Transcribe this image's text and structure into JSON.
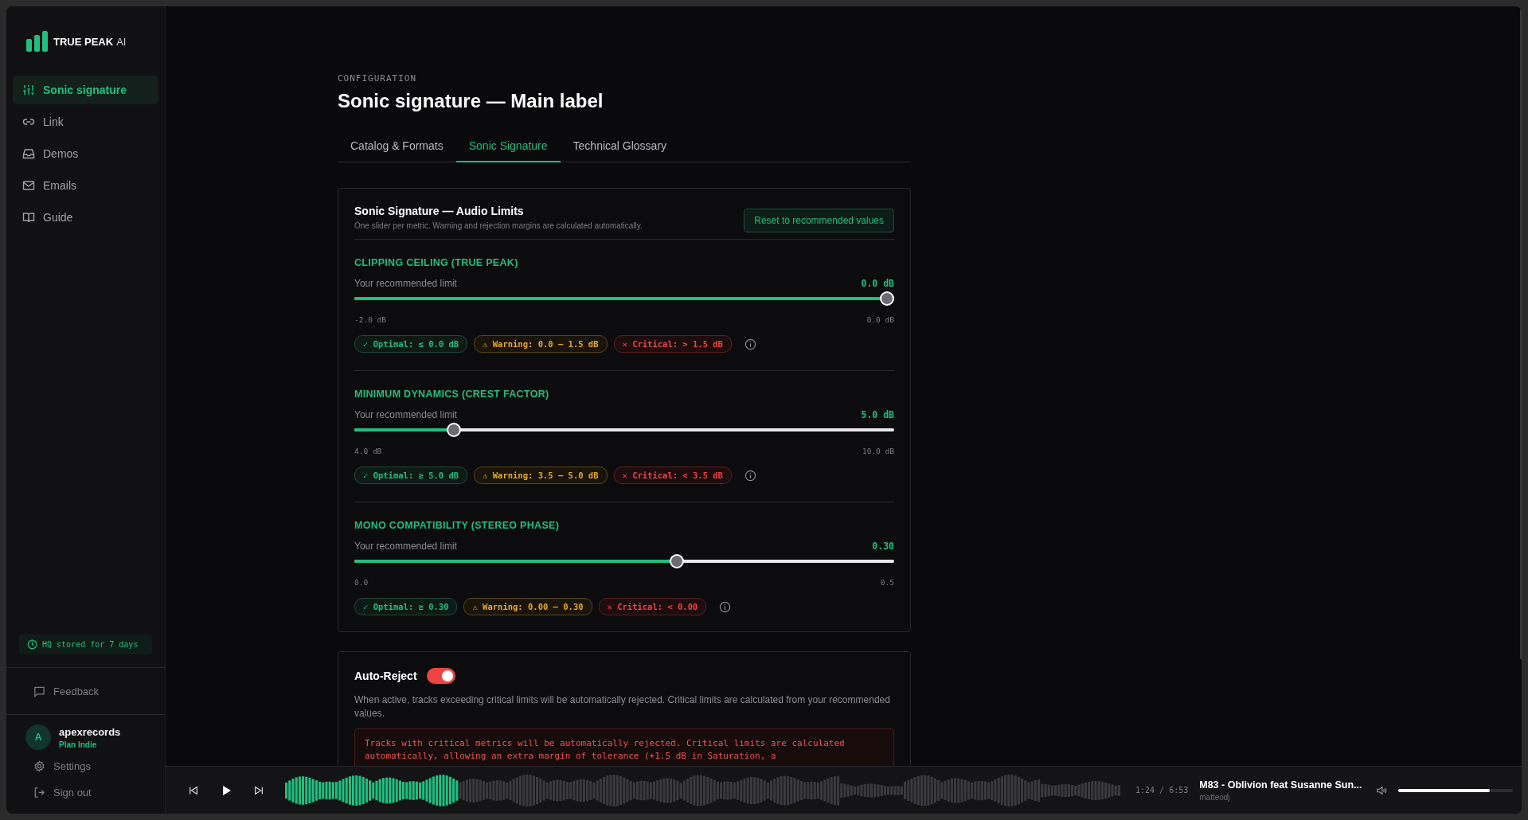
{
  "brand": {
    "name": "TRUE PEAK",
    "suffix": "AI"
  },
  "sidebar": {
    "items": [
      {
        "label": "Sonic signature",
        "kind": "sliders",
        "selected": true
      },
      {
        "label": "Link",
        "kind": "link",
        "selected": false
      },
      {
        "label": "Demos",
        "kind": "inbox",
        "selected": false
      },
      {
        "label": "Emails",
        "kind": "mail",
        "selected": false
      },
      {
        "label": "Guide",
        "kind": "book",
        "selected": false
      }
    ],
    "storage_note": "HQ stored for 7 days",
    "feedback": "Feedback",
    "user": {
      "initial": "A",
      "name": "apexrecords",
      "plan": "Plan Indie"
    },
    "links": [
      {
        "label": "Settings",
        "kind": "gear"
      },
      {
        "label": "Sign out",
        "kind": "signout"
      }
    ]
  },
  "header": {
    "eyebrow": "CONFIGURATION",
    "title": "Sonic signature — Main label"
  },
  "tabs": [
    {
      "label": "Catalog & Formats",
      "selected": false
    },
    {
      "label": "Sonic Signature",
      "selected": true
    },
    {
      "label": "Technical Glossary",
      "selected": false
    }
  ],
  "limits_card": {
    "title": "Sonic Signature — Audio Limits",
    "subtitle": "One slider per metric. Warning and rejection margins are calculated automatically.",
    "reset_button": "Reset to recommended values",
    "metrics": [
      {
        "name": "CLIPPING CEILING (TRUE PEAK)",
        "caption": "Your recommended limit",
        "value": "0.0 dB",
        "level": 1,
        "min": "-2.0 dB",
        "max": "0.0 dB",
        "badges": [
          {
            "kind": "optimal",
            "symbol": "✓",
            "text": "Optimal: ≤ 0.0 dB"
          },
          {
            "kind": "warning",
            "symbol": "⚠",
            "text": "Warning: 0.0 — 1.5 dB"
          },
          {
            "kind": "critical",
            "symbol": "✕",
            "text": "Critical: > 1.5 dB"
          }
        ]
      },
      {
        "name": "MINIMUM DYNAMICS (CREST FACTOR)",
        "caption": "Your recommended limit",
        "value": "5.0 dB",
        "level": 0.175,
        "min": "4.0 dB",
        "max": "10.0 dB",
        "badges": [
          {
            "kind": "optimal",
            "symbol": "✓",
            "text": "Optimal: ≥ 5.0 dB"
          },
          {
            "kind": "warning",
            "symbol": "⚠",
            "text": "Warning: 3.5 — 5.0 dB"
          },
          {
            "kind": "critical",
            "symbol": "✕",
            "text": "Critical: < 3.5 dB"
          }
        ]
      },
      {
        "name": "MONO COMPATIBILITY (STEREO PHASE)",
        "caption": "Your recommended limit",
        "value": "0.30",
        "level": 0.6,
        "min": "0.0",
        "max": "0.5",
        "badges": [
          {
            "kind": "optimal",
            "symbol": "✓",
            "text": "Optimal: ≥ 0.30"
          },
          {
            "kind": "warning",
            "symbol": "⚠",
            "text": "Warning: 0.00 — 0.30"
          },
          {
            "kind": "critical",
            "symbol": "✕",
            "text": "Critical: < 0.00"
          }
        ]
      }
    ]
  },
  "auto_reject": {
    "label": "Auto-Reject",
    "on": true,
    "description": "When active, tracks exceeding critical limits will be automatically rejected. Critical limits are calculated from your recommended values.",
    "warning": "Tracks with critical metrics will be automatically rejected. Critical limits are calculated automatically, allowing an extra margin of tolerance (+1.5 dB in Saturation, a"
  },
  "player": {
    "level": 0.205,
    "time": "1:24 / 6:53",
    "track": "M83 - Oblivion feat Susanne Sun...",
    "artist": "matteodj",
    "volume": {
      "level": 0.8
    }
  }
}
